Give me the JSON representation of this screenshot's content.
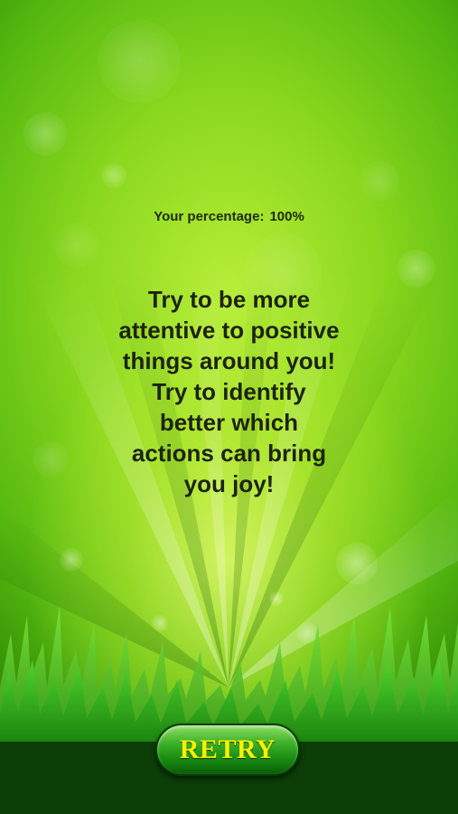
{
  "result": {
    "percentage_label": "Your percentage:",
    "percentage_value": "100%"
  },
  "message": {
    "lines": [
      "Try to be more",
      "attentive to positive",
      "things around you!",
      "Try to identify",
      "better which",
      "actions can bring",
      "you joy!"
    ]
  },
  "retry_button": {
    "label": "RETRY"
  },
  "colors": {
    "background_center": "#b8ee3a",
    "background_edge": "#2f8a06",
    "text": "#1d2310",
    "button_green": "#178a12",
    "button_text": "#f6f200"
  }
}
